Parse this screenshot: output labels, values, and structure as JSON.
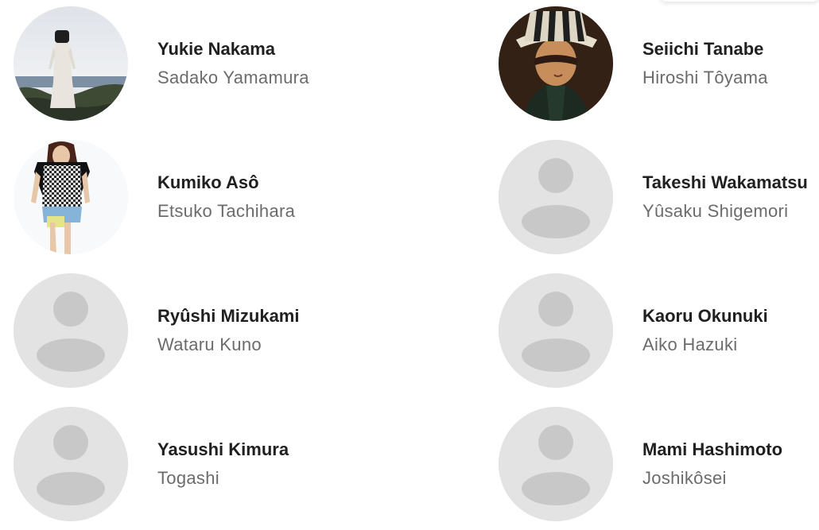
{
  "cast": [
    {
      "actor": "Yukie Nakama",
      "role": "Sadako Yamamura",
      "photo": "photo-woman-white-dress-seaside"
    },
    {
      "actor": "Seiichi Tanabe",
      "role": "Hiroshi Tôyama",
      "photo": "photo-man-striped-hat"
    },
    {
      "actor": "Kumiko Asô",
      "role": "Etsuko Tachihara",
      "photo": "photo-woman-checkered-top"
    },
    {
      "actor": "Takeshi Wakamatsu",
      "role": "Yûsaku Shigemori",
      "photo": "placeholder-person-icon"
    },
    {
      "actor": "Ryûshi Mizukami",
      "role": "Wataru Kuno",
      "photo": "placeholder-person-icon"
    },
    {
      "actor": "Kaoru Okunuki",
      "role": "Aiko Hazuki",
      "photo": "placeholder-person-icon"
    },
    {
      "actor": "Yasushi Kimura",
      "role": "Togashi",
      "photo": "placeholder-person-icon"
    },
    {
      "actor": "Mami Hashimoto",
      "role": "Joshikôsei",
      "photo": "placeholder-person-icon"
    }
  ],
  "colors": {
    "actor_text": "#202020",
    "role_text": "#6b6b6b",
    "placeholder_bg": "#e3e3e3",
    "placeholder_fg": "#c8c8c8"
  }
}
